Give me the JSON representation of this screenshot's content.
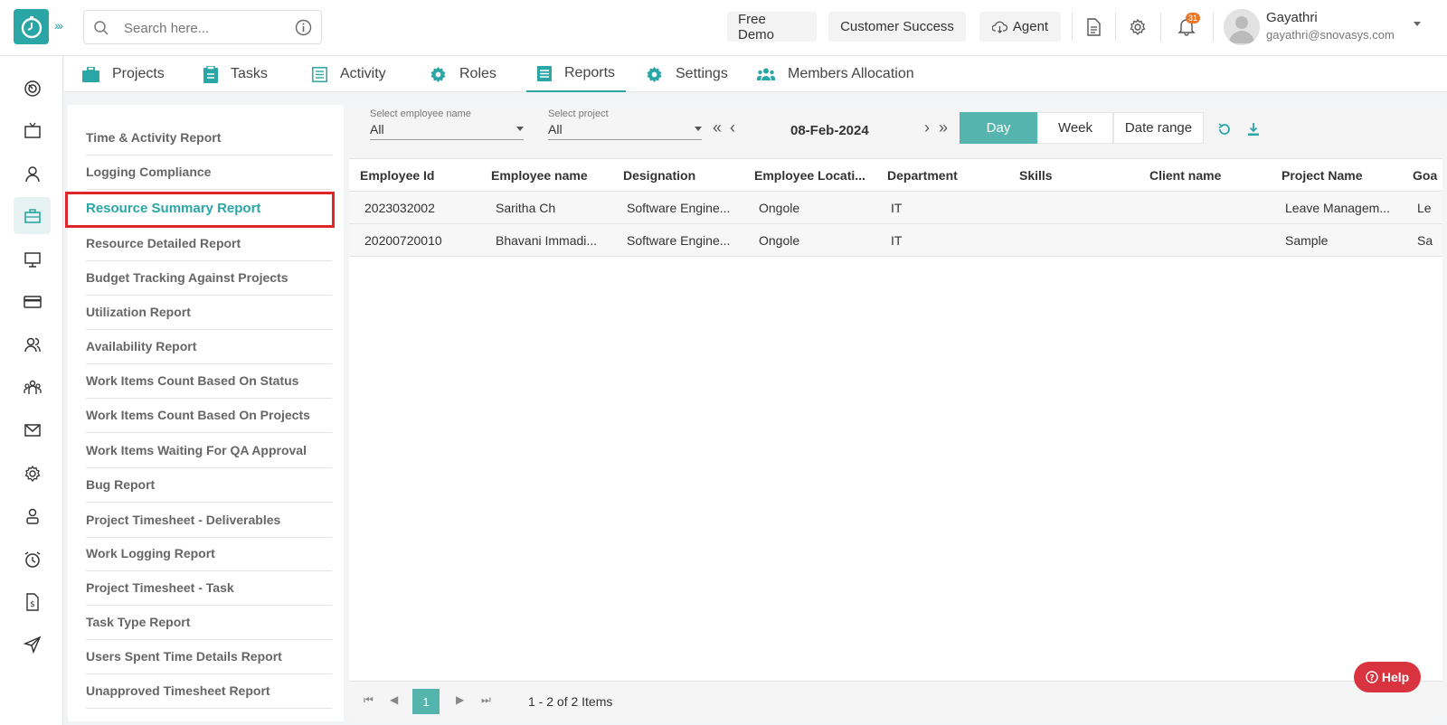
{
  "header": {
    "search_placeholder": "Search here...",
    "free_demo": "Free Demo",
    "customer_success": "Customer Success",
    "agent": "Agent",
    "notification_count": "31",
    "user_name": "Gayathri",
    "user_email": "gayathri@snovasys.com"
  },
  "nav_tabs": [
    {
      "label": "Projects",
      "icon": "briefcase-icon"
    },
    {
      "label": "Tasks",
      "icon": "clipboard-icon"
    },
    {
      "label": "Activity",
      "icon": "list-icon"
    },
    {
      "label": "Roles",
      "icon": "gear-icon"
    },
    {
      "label": "Reports",
      "icon": "document-icon",
      "active": true
    },
    {
      "label": "Settings",
      "icon": "gear-icon"
    },
    {
      "label": "Members Allocation",
      "icon": "people-icon"
    }
  ],
  "reports": [
    "Time & Activity Report",
    "Logging Compliance",
    "Resource Summary Report",
    "Resource Detailed Report",
    "Budget Tracking Against Projects",
    "Utilization Report",
    "Availability Report",
    "Work Items Count Based On Status",
    "Work Items Count Based On Projects",
    "Work Items Waiting For QA Approval",
    "Bug Report",
    "Project Timesheet - Deliverables",
    "Work Logging Report",
    "Project Timesheet - Task",
    "Task Type Report",
    "Users Spent Time Details Report",
    "Unapproved Timesheet Report"
  ],
  "filters": {
    "employee_label": "Select employee name",
    "employee_value": "All",
    "project_label": "Select project",
    "project_value": "All",
    "date": "08-Feb-2024",
    "day": "Day",
    "week": "Week",
    "date_range": "Date range"
  },
  "table": {
    "columns": [
      "Employee Id",
      "Employee name",
      "Designation",
      "Employee Locati...",
      "Department",
      "Skills",
      "Client name",
      "Project Name",
      "Goa"
    ],
    "rows": [
      [
        "2023032002",
        "Saritha Ch",
        "Software Engine...",
        "Ongole",
        "IT",
        "",
        "",
        "Leave Managem...",
        "Le"
      ],
      [
        "20200720010",
        "Bhavani Immadi...",
        "Software Engine...",
        "Ongole",
        "IT",
        "",
        "",
        "Sample",
        "Sa"
      ]
    ]
  },
  "pager": {
    "page": "1",
    "info": "1 - 2 of 2 Items"
  },
  "help": "Help",
  "colors": {
    "accent": "#2aa6a6",
    "active_segment": "#55b4ad",
    "highlight_border": "#e0262c",
    "help_button": "#d9333f"
  }
}
